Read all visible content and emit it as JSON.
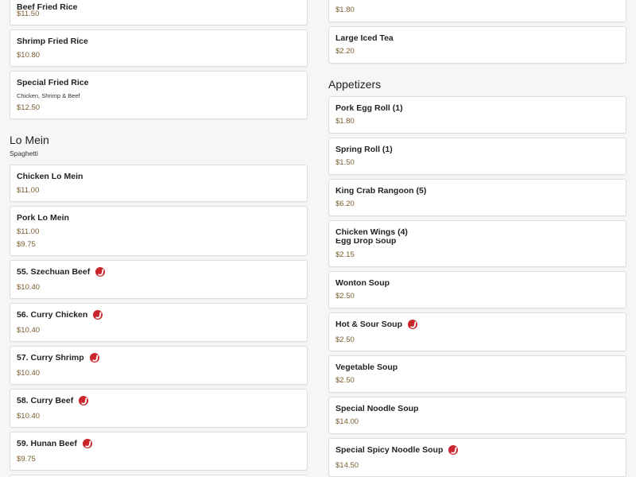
{
  "top": {
    "left": {
      "partial_item": {
        "name": "Beef Fried Rice",
        "price": "$11.50"
      },
      "items": [
        {
          "name": "Shrimp Fried Rice",
          "price": "$10.80"
        },
        {
          "name": "Special Fried Rice",
          "desc": "Chicken, Shrimp & Beef",
          "price": "$12.50"
        }
      ],
      "section": {
        "title": "Lo Mein",
        "subtitle": "Spaghetti"
      },
      "section_items": [
        {
          "name": "Chicken Lo Mein",
          "price": "$11.00"
        },
        {
          "name": "Pork Lo Mein",
          "price": "$11.00"
        }
      ]
    },
    "right": {
      "partial_item": {
        "price": "$1.80"
      },
      "items": [
        {
          "name": "Large Iced Tea",
          "price": "$2.20"
        }
      ],
      "section": {
        "title": "Appetizers"
      },
      "section_items": [
        {
          "name": "Pork Egg Roll (1)",
          "price": "$1.80"
        },
        {
          "name": "Spring Roll (1)",
          "price": "$1.50"
        },
        {
          "name": "King Crab Rangoon (5)",
          "price": "$6.20"
        },
        {
          "name": "Chicken Wings (4)"
        }
      ]
    }
  },
  "bottom": {
    "left": {
      "partial_item": {
        "price": "$9.75"
      },
      "items": [
        {
          "name": "55. Szechuan Beef",
          "price": "$10.40",
          "spicy": true
        },
        {
          "name": "56. Curry Chicken",
          "price": "$10.40",
          "spicy": true
        },
        {
          "name": "57. Curry Shrimp",
          "price": "$10.40",
          "spicy": true
        },
        {
          "name": "58. Curry Beef",
          "price": "$10.40",
          "spicy": true
        },
        {
          "name": "59. Hunan Beef",
          "price": "$9.75",
          "spicy": true
        }
      ]
    },
    "right": {
      "partial_item": {
        "name": "Egg Drop Soup",
        "price": "$2.15"
      },
      "items": [
        {
          "name": "Wonton Soup",
          "price": "$2.50"
        },
        {
          "name": "Hot & Sour Soup",
          "price": "$2.50",
          "spicy": true
        },
        {
          "name": "Vegetable Soup",
          "price": "$2.50"
        },
        {
          "name": "Special Noodle Soup",
          "price": "$14.00"
        },
        {
          "name": "Special Spicy Noodle Soup",
          "price": "$14.50",
          "spicy": true
        }
      ]
    }
  },
  "icons": {
    "spicy": "chili-pepper-icon"
  },
  "colors": {
    "spicy": "#c8262c",
    "price": "#7a5c2e",
    "card_border": "#dddddd"
  }
}
